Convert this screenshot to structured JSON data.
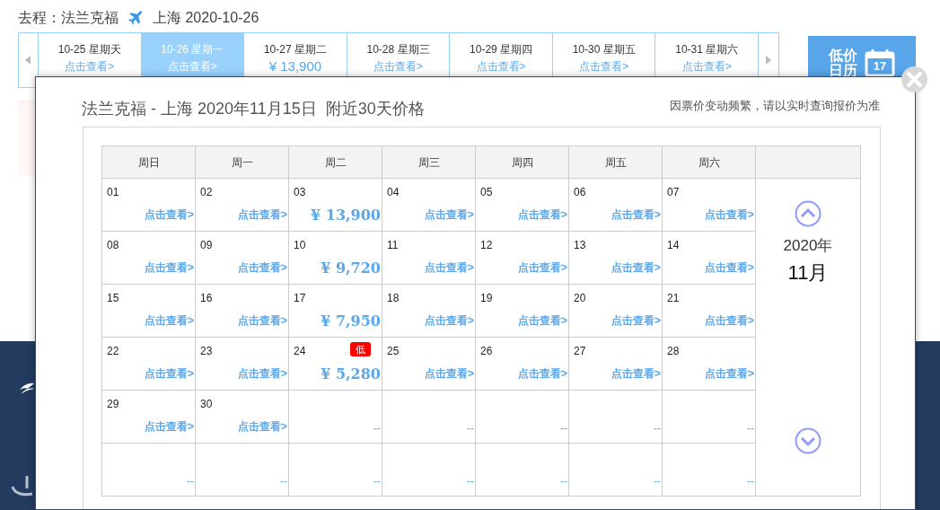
{
  "trip": {
    "origin": "去程：法兰克福",
    "destination": "上海 2020-10-26"
  },
  "date_strip": [
    {
      "date": "10-25 星期天",
      "kind": "link",
      "text": "点击查看>",
      "selected": false
    },
    {
      "date": "10-26 星期一",
      "kind": "link",
      "text": "点击查看>",
      "selected": true
    },
    {
      "date": "10-27 星期二",
      "kind": "price",
      "text": "¥ 13,900",
      "selected": false
    },
    {
      "date": "10-28 星期三",
      "kind": "link",
      "text": "点击查看>",
      "selected": false
    },
    {
      "date": "10-29 星期四",
      "kind": "link",
      "text": "点击查看>",
      "selected": false
    },
    {
      "date": "10-30 星期五",
      "kind": "link",
      "text": "点击查看>",
      "selected": false
    },
    {
      "date": "10-31 星期六",
      "kind": "link",
      "text": "点击查看>",
      "selected": false
    }
  ],
  "low_price_button": {
    "lines": [
      "低价",
      "日历"
    ],
    "icon_day": "17"
  },
  "modal": {
    "title": "法兰克福 - 上海 2020年11月15日  附近30天价格",
    "notice": "因票价变动频繁，请以实时查询报价为准",
    "weekdays": [
      "周日",
      "周一",
      "周二",
      "周三",
      "周四",
      "周五",
      "周六"
    ],
    "year": "2020年",
    "month": "11月",
    "weeks": [
      [
        {
          "day": "01",
          "kind": "link",
          "text": "点击查看>"
        },
        {
          "day": "02",
          "kind": "link",
          "text": "点击查看>"
        },
        {
          "day": "03",
          "kind": "price",
          "text": "¥ 13,900"
        },
        {
          "day": "04",
          "kind": "link",
          "text": "点击查看>"
        },
        {
          "day": "05",
          "kind": "link",
          "text": "点击查看>"
        },
        {
          "day": "06",
          "kind": "link",
          "text": "点击查看>"
        },
        {
          "day": "07",
          "kind": "link",
          "text": "点击查看>"
        }
      ],
      [
        {
          "day": "08",
          "kind": "link",
          "text": "点击查看>"
        },
        {
          "day": "09",
          "kind": "link",
          "text": "点击查看>"
        },
        {
          "day": "10",
          "kind": "price",
          "text": "¥ 9,720"
        },
        {
          "day": "11",
          "kind": "link",
          "text": "点击查看>"
        },
        {
          "day": "12",
          "kind": "link",
          "text": "点击查看>"
        },
        {
          "day": "13",
          "kind": "link",
          "text": "点击查看>"
        },
        {
          "day": "14",
          "kind": "link",
          "text": "点击查看>"
        }
      ],
      [
        {
          "day": "15",
          "kind": "link",
          "text": "点击查看>"
        },
        {
          "day": "16",
          "kind": "link",
          "text": "点击查看>"
        },
        {
          "day": "17",
          "kind": "price",
          "text": "¥ 7,950"
        },
        {
          "day": "18",
          "kind": "link",
          "text": "点击查看>"
        },
        {
          "day": "19",
          "kind": "link",
          "text": "点击查看>"
        },
        {
          "day": "20",
          "kind": "link",
          "text": "点击查看>"
        },
        {
          "day": "21",
          "kind": "link",
          "text": "点击查看>"
        }
      ],
      [
        {
          "day": "22",
          "kind": "link",
          "text": "点击查看>"
        },
        {
          "day": "23",
          "kind": "link",
          "text": "点击查看>"
        },
        {
          "day": "24",
          "kind": "price",
          "text": "¥ 5,280",
          "badge": "低"
        },
        {
          "day": "25",
          "kind": "link",
          "text": "点击查看>"
        },
        {
          "day": "26",
          "kind": "link",
          "text": "点击查看>"
        },
        {
          "day": "27",
          "kind": "link",
          "text": "点击查看>"
        },
        {
          "day": "28",
          "kind": "link",
          "text": "点击查看>"
        }
      ],
      [
        {
          "day": "29",
          "kind": "link",
          "text": "点击查看>"
        },
        {
          "day": "30",
          "kind": "link",
          "text": "点击查看>"
        },
        {
          "kind": "empty",
          "text": "--"
        },
        {
          "kind": "empty",
          "text": "--"
        },
        {
          "kind": "empty",
          "text": "--"
        },
        {
          "kind": "empty",
          "text": "--"
        },
        {
          "kind": "empty",
          "text": "--"
        }
      ],
      [
        {
          "kind": "empty",
          "text": "--"
        },
        {
          "kind": "empty",
          "text": "--"
        },
        {
          "kind": "empty",
          "text": "--"
        },
        {
          "kind": "empty",
          "text": "--"
        },
        {
          "kind": "empty",
          "text": "--"
        },
        {
          "kind": "empty",
          "text": "--"
        },
        {
          "kind": "empty",
          "text": "--"
        }
      ]
    ]
  }
}
